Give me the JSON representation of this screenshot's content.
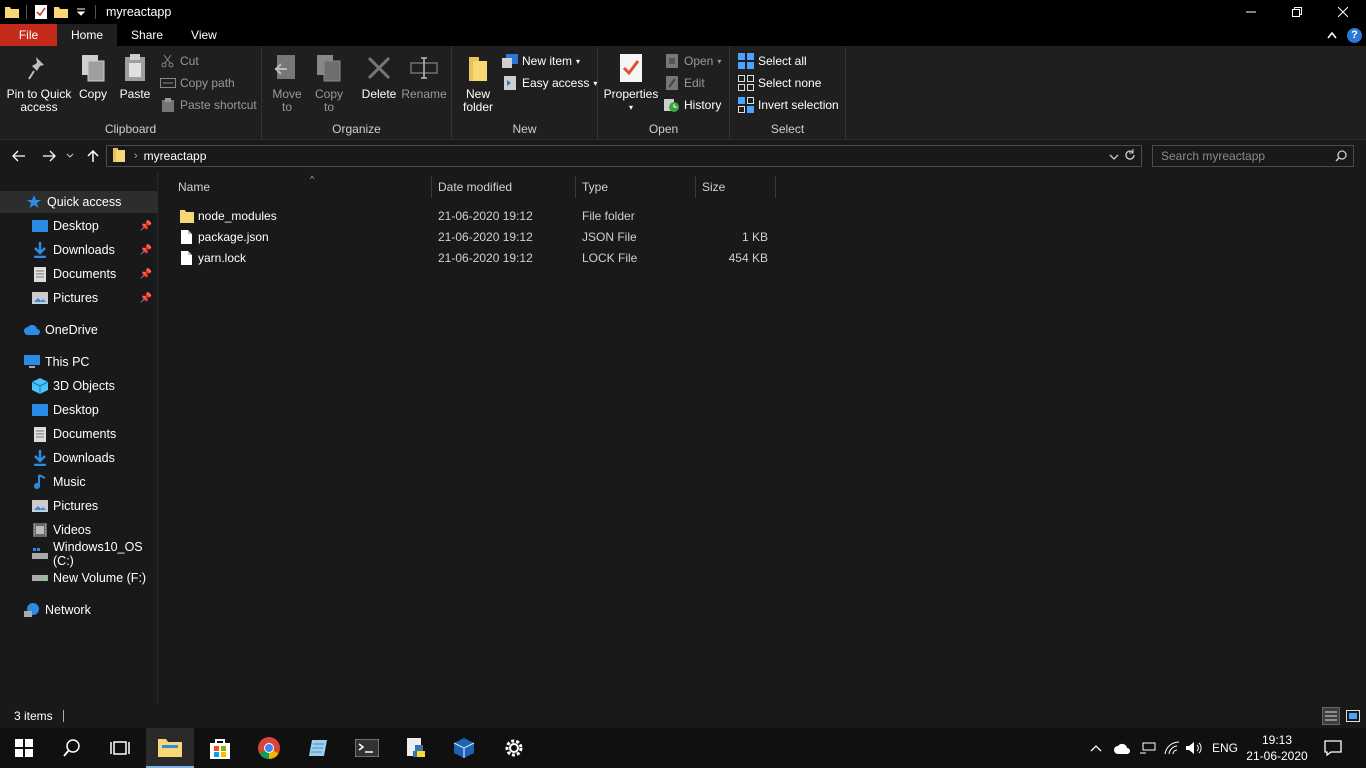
{
  "window": {
    "title": "myreactapp"
  },
  "tabs": {
    "file": "File",
    "home": "Home",
    "share": "Share",
    "view": "View"
  },
  "ribbon": {
    "clipboard": {
      "label": "Clipboard",
      "pin": "Pin to Quick access",
      "pin_l1": "Pin to Quick",
      "pin_l2": "access",
      "copy": "Copy",
      "paste": "Paste",
      "cut": "Cut",
      "copy_path": "Copy path",
      "paste_shortcut": "Paste shortcut"
    },
    "organize": {
      "label": "Organize",
      "move_l1": "Move",
      "move_l2": "to",
      "copy_l1": "Copy",
      "copy_l2": "to",
      "delete": "Delete",
      "rename": "Rename"
    },
    "new": {
      "label": "New",
      "folder_l1": "New",
      "folder_l2": "folder",
      "new_item": "New item",
      "easy_access": "Easy access"
    },
    "open": {
      "label": "Open",
      "properties": "Properties",
      "open": "Open",
      "edit": "Edit",
      "history": "History"
    },
    "select": {
      "label": "Select",
      "select_all": "Select all",
      "select_none": "Select none",
      "invert": "Invert selection"
    }
  },
  "address": {
    "crumb": "myreactapp",
    "search_placeholder": "Search myreactapp"
  },
  "nav": {
    "quick_access": "Quick access",
    "qa_desktop": "Desktop",
    "qa_downloads": "Downloads",
    "qa_documents": "Documents",
    "qa_pictures": "Pictures",
    "onedrive": "OneDrive",
    "this_pc": "This PC",
    "pc_3d": "3D Objects",
    "pc_desktop": "Desktop",
    "pc_documents": "Documents",
    "pc_downloads": "Downloads",
    "pc_music": "Music",
    "pc_pictures": "Pictures",
    "pc_videos": "Videos",
    "pc_c": "Windows10_OS (C:)",
    "pc_f": "New Volume (F:)",
    "network": "Network"
  },
  "columns": {
    "name": "Name",
    "date": "Date modified",
    "type": "Type",
    "size": "Size"
  },
  "files": [
    {
      "name": "node_modules",
      "date": "21-06-2020 19:12",
      "type": "File folder",
      "size": ""
    },
    {
      "name": "package.json",
      "date": "21-06-2020 19:12",
      "type": "JSON File",
      "size": "1 KB"
    },
    {
      "name": "yarn.lock",
      "date": "21-06-2020 19:12",
      "type": "LOCK File",
      "size": "454 KB"
    }
  ],
  "status": {
    "count": "3 items"
  },
  "tray": {
    "lang": "ENG",
    "time": "19:13",
    "date": "21-06-2020"
  },
  "colors": {
    "folder": "#f8d775",
    "accent": "#2b78d6",
    "file_tab": "#c42b1c"
  }
}
